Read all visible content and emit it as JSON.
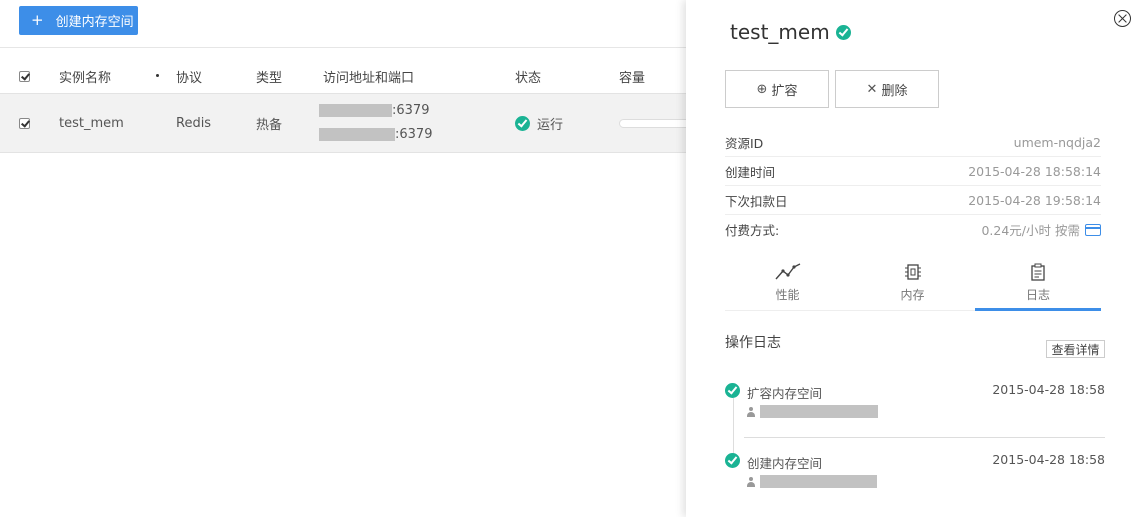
{
  "toolbar": {
    "create_label": "创建内存空间",
    "create_icon": "plus-icon"
  },
  "table": {
    "columns": [
      "实例名称",
      "协议",
      "类型",
      "访问地址和端口",
      "状态",
      "容量"
    ],
    "rows": [
      {
        "name": "test_mem",
        "protocol": "Redis",
        "type": "热备",
        "addresses": [
          ":6379",
          ":6379"
        ],
        "status": "运行",
        "checked": true
      }
    ]
  },
  "panel": {
    "title": "test_mem",
    "actions": {
      "expand_label": "扩容",
      "delete_label": "删除"
    },
    "info": [
      {
        "key": "资源ID",
        "value": "umem-nqdja2"
      },
      {
        "key": "创建时间",
        "value": "2015-04-28 18:58:14"
      },
      {
        "key": "下次扣款日",
        "value": "2015-04-28 19:58:14"
      },
      {
        "key": "付费方式:",
        "value": "0.24元/小时 按需"
      }
    ],
    "tabs": [
      {
        "label": "性能",
        "icon": "line-chart-icon"
      },
      {
        "label": "内存",
        "icon": "chip-icon"
      },
      {
        "label": "日志",
        "icon": "clipboard-icon",
        "active": true
      }
    ],
    "log": {
      "title": "操作日志",
      "detail_label": "查看详情",
      "items": [
        {
          "name": "扩容内存空间",
          "time": "2015-04-28 18:58"
        },
        {
          "name": "创建内存空间",
          "time": "2015-04-28 18:58"
        }
      ]
    }
  },
  "colors": {
    "accent": "#3d8ee8",
    "success": "#1ab394"
  }
}
